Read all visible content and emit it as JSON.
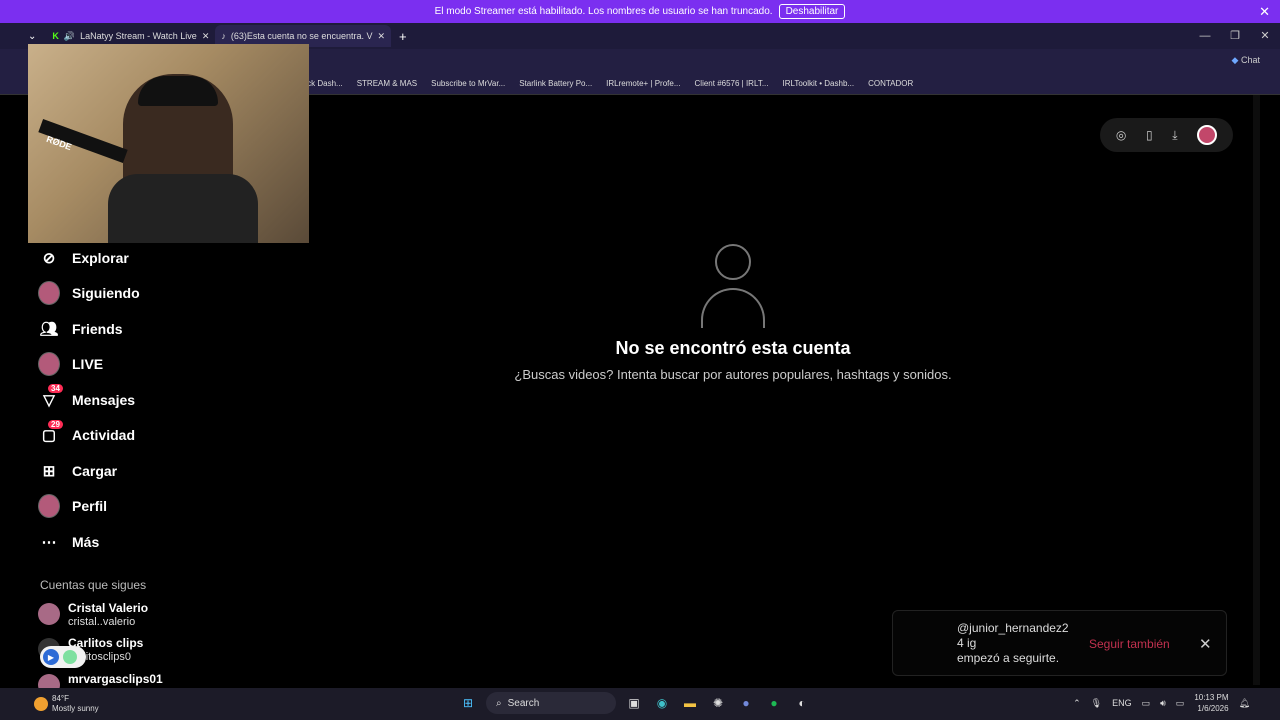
{
  "streamer_banner": {
    "message": "El modo Streamer está habilitado. Los nombres de usuario se han truncado.",
    "button": "Deshabilitar"
  },
  "tabs": [
    {
      "title": "LaNatyy Stream - Watch Live"
    },
    {
      "title": "(63)Esta cuenta no se encuentra. V"
    }
  ],
  "address_bar": {
    "chat_label": "Chat"
  },
  "bookmarks": [
    "Kick Dash...",
    "STREAM & MAS",
    "Subscribe to MrVar...",
    "Starlink Battery Po...",
    "IRLremote+ | Profe...",
    "Client #6576 | IRLT...",
    "IRLToolkit • Dashb...",
    "CONTADOR"
  ],
  "webcam": {
    "mic_brand": "RØDE"
  },
  "sidebar": {
    "items": [
      {
        "label": "Explorar",
        "icon": "compass-icon"
      },
      {
        "label": "Siguiendo",
        "icon": "avatar"
      },
      {
        "label": "Friends",
        "icon": "friends-icon"
      },
      {
        "label": "LIVE",
        "icon": "avatar"
      },
      {
        "label": "Mensajes",
        "icon": "messages-icon",
        "badge": "34"
      },
      {
        "label": "Actividad",
        "icon": "activity-icon",
        "badge": "29"
      },
      {
        "label": "Cargar",
        "icon": "upload-icon"
      },
      {
        "label": "Perfil",
        "icon": "avatar"
      },
      {
        "label": "Más",
        "icon": "more-icon"
      }
    ],
    "following_heading": "Cuentas que sigues",
    "accounts": [
      {
        "name": "Cristal Valerio",
        "handle": "cristal..valerio"
      },
      {
        "name": "Carlitos clips",
        "handle": "carlitosclips0"
      },
      {
        "name": "mrvargasclips01",
        "handle": ""
      }
    ]
  },
  "main": {
    "title": "No se encontró esta cuenta",
    "subtitle": "¿Buscas videos? Intenta buscar por autores populares, hashtags y sonidos."
  },
  "toast": {
    "username": "@junior_hernandez2",
    "username_suffix": "4 ig",
    "message": "empezó a seguirte.",
    "action": "Seguir también"
  },
  "taskbar": {
    "temperature": "84°F",
    "weather": "Mostly sunny",
    "search": "Search",
    "language": "ENG",
    "time": "10:13 PM",
    "date": "1/6/2026"
  }
}
